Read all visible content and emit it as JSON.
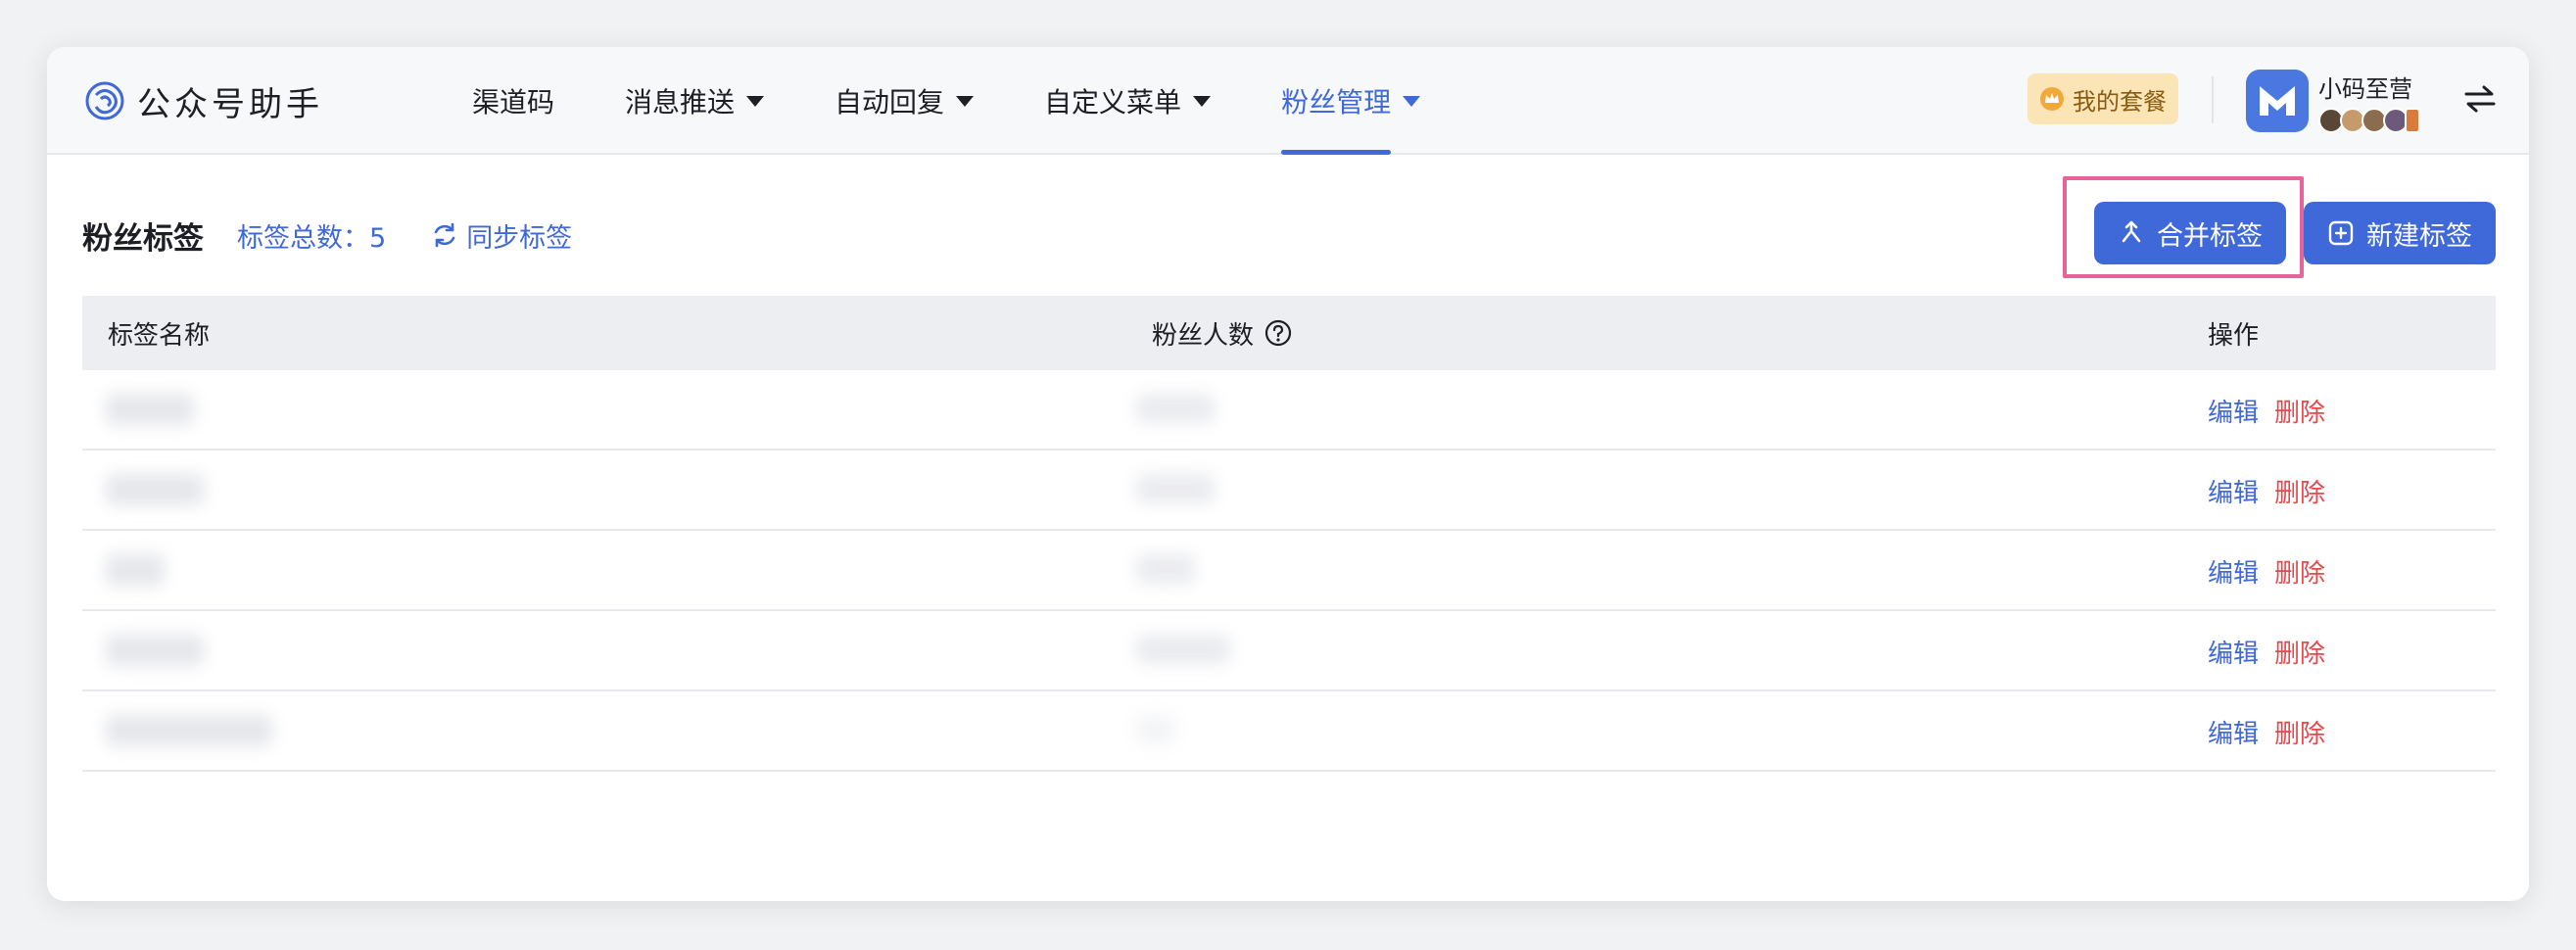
{
  "brand": {
    "name": "公众号助手",
    "icon": "brand-logo-icon"
  },
  "nav": [
    {
      "label": "渠道码",
      "dropdown": false,
      "active": false
    },
    {
      "label": "消息推送",
      "dropdown": true,
      "active": false
    },
    {
      "label": "自动回复",
      "dropdown": true,
      "active": false
    },
    {
      "label": "自定义菜单",
      "dropdown": true,
      "active": false
    },
    {
      "label": "粉丝管理",
      "dropdown": true,
      "active": true
    }
  ],
  "plan": {
    "label": "我的套餐",
    "icon": "crown-icon"
  },
  "account": {
    "name": "小码至营",
    "avatar_icon": "m-logo-icon"
  },
  "toolbar": {
    "title": "粉丝标签",
    "tag_count": "标签总数：5",
    "sync_label": "同步标签"
  },
  "actions": {
    "merge_label": "合并标签",
    "new_label": "新建标签"
  },
  "table": {
    "headers": {
      "name": "标签名称",
      "count": "粉丝人数",
      "ops": "操作"
    },
    "rows": [
      {
        "edit": "编辑",
        "delete": "删除"
      },
      {
        "edit": "编辑",
        "delete": "删除"
      },
      {
        "edit": "编辑",
        "delete": "删除"
      },
      {
        "edit": "编辑",
        "delete": "删除"
      },
      {
        "edit": "编辑",
        "delete": "删除"
      }
    ]
  },
  "colors": {
    "accent": "#3f68d8",
    "danger": "#e5484d",
    "highlight": "#e8639a",
    "plan_bg": "#fbe5b6"
  }
}
